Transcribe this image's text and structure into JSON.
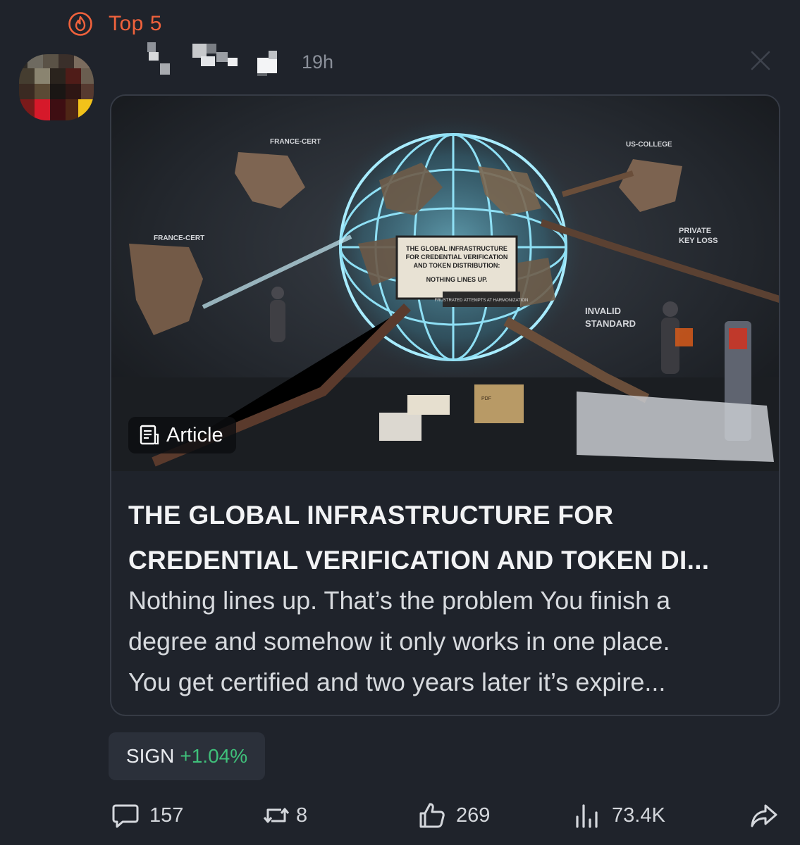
{
  "badge": {
    "label": "Top 5",
    "icon": "fire-icon",
    "color": "#f0623c"
  },
  "post": {
    "time": "19h",
    "card": {
      "badge_label": "Article",
      "image_text": {
        "headline_lines": [
          "THE GLOBAL INFRASTRUCTURE",
          "FOR CREDENTIAL VERIFICATION",
          "AND TOKEN DISTRIBUTION:",
          "NOTHING LINES UP."
        ],
        "subline": "FRUSTRATED ATTEMPTS AT HARMONIZATION",
        "label_france_cert": "FRANCE-CERT",
        "label_us_college": "US-COLLEGE",
        "label_private_key_1": "PRIVATE",
        "label_private_key_2": "KEY LOSS",
        "label_invalid_1": "INVALID",
        "label_invalid_2": "STANDARD",
        "label_pdf": "PDF"
      },
      "title_line1": "THE GLOBAL INFRASTRUCTURE FOR",
      "title_line2": "CREDENTIAL VERIFICATION AND TOKEN DI...",
      "desc_line1": "Nothing lines up. That’s the problem You finish a",
      "desc_line2": "degree and somehow it only works in one place.",
      "desc_line3": "You get certified and two years later it’s expire..."
    },
    "ticker": {
      "symbol": "SIGN",
      "change": "+1.04%",
      "change_color": "#3fc07a"
    },
    "actions": {
      "comments": "157",
      "reposts": "8",
      "likes": "269",
      "views": "73.4K"
    }
  }
}
